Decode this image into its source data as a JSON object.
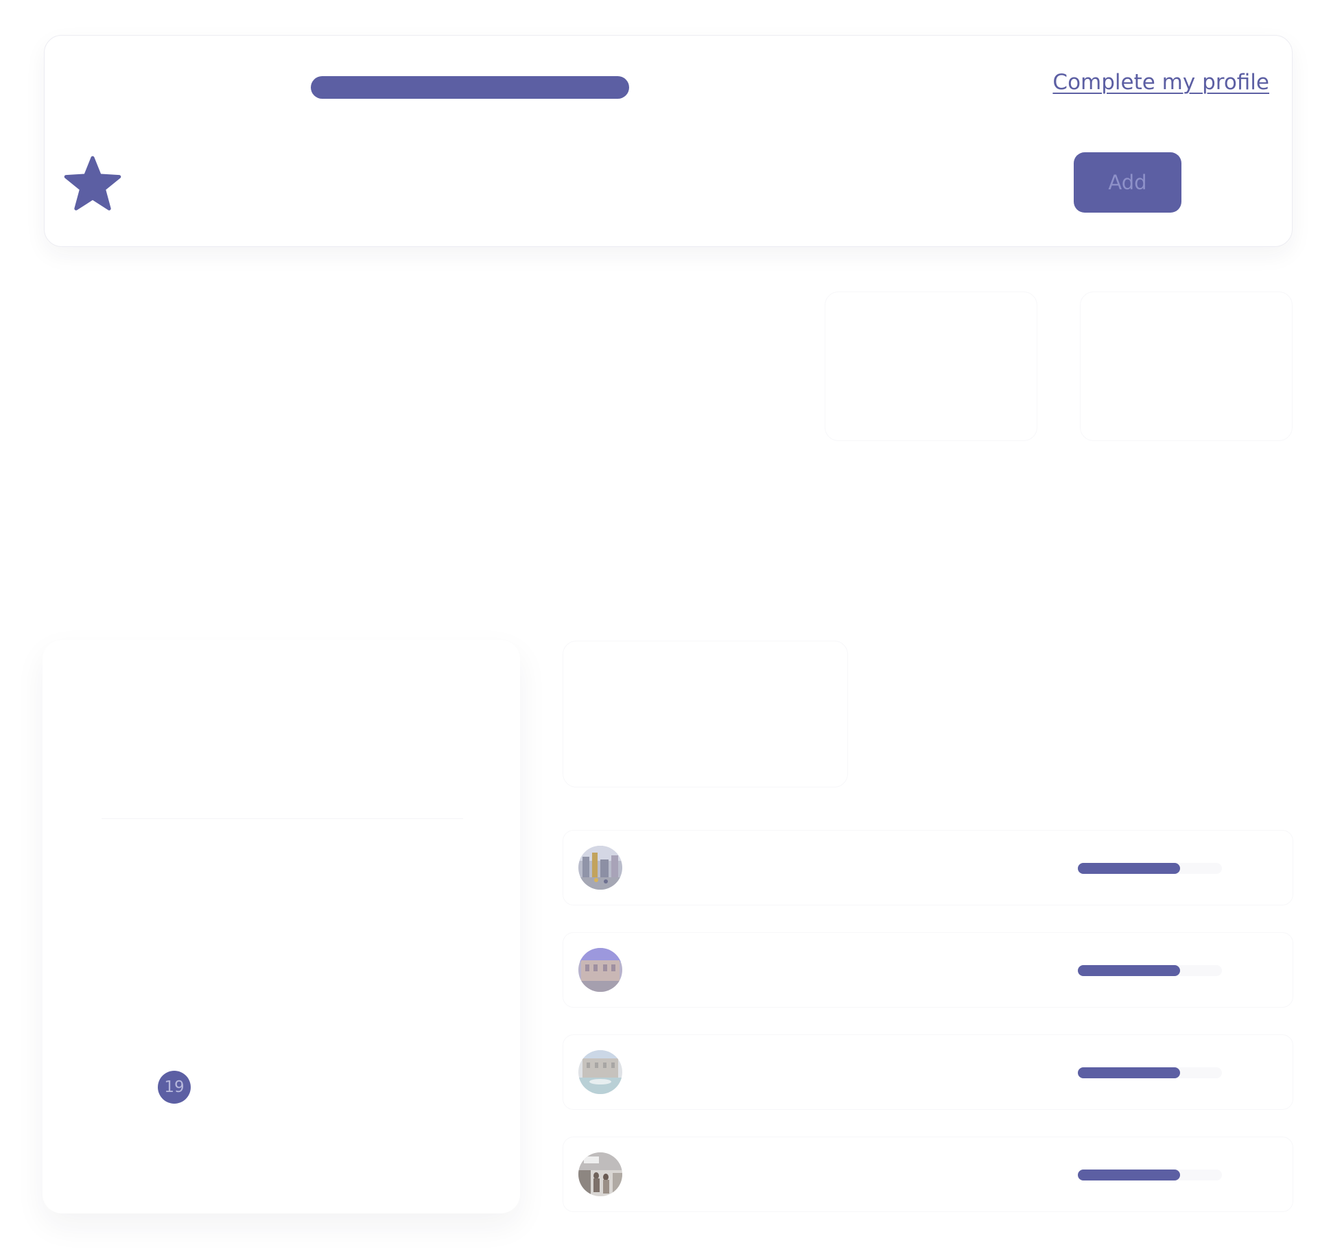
{
  "colors": {
    "accent": "#5c5fa3",
    "add_button_text": "#8e91c9",
    "link": "#5c5fa3"
  },
  "profile": {
    "complete_profile_link": "Complete my profile",
    "add_button_label": "Add",
    "profile_completion": 1.0,
    "star_icon": "star-icon"
  },
  "calendar": {
    "highlighted_day": "19"
  },
  "trips": [
    {
      "avatar_icon": "city-square-photo",
      "progress": 0.71
    },
    {
      "avatar_icon": "palace-photo",
      "progress": 0.71
    },
    {
      "avatar_icon": "fountain-photo",
      "progress": 0.71
    },
    {
      "avatar_icon": "street-people-photo",
      "progress": 0.71
    }
  ]
}
